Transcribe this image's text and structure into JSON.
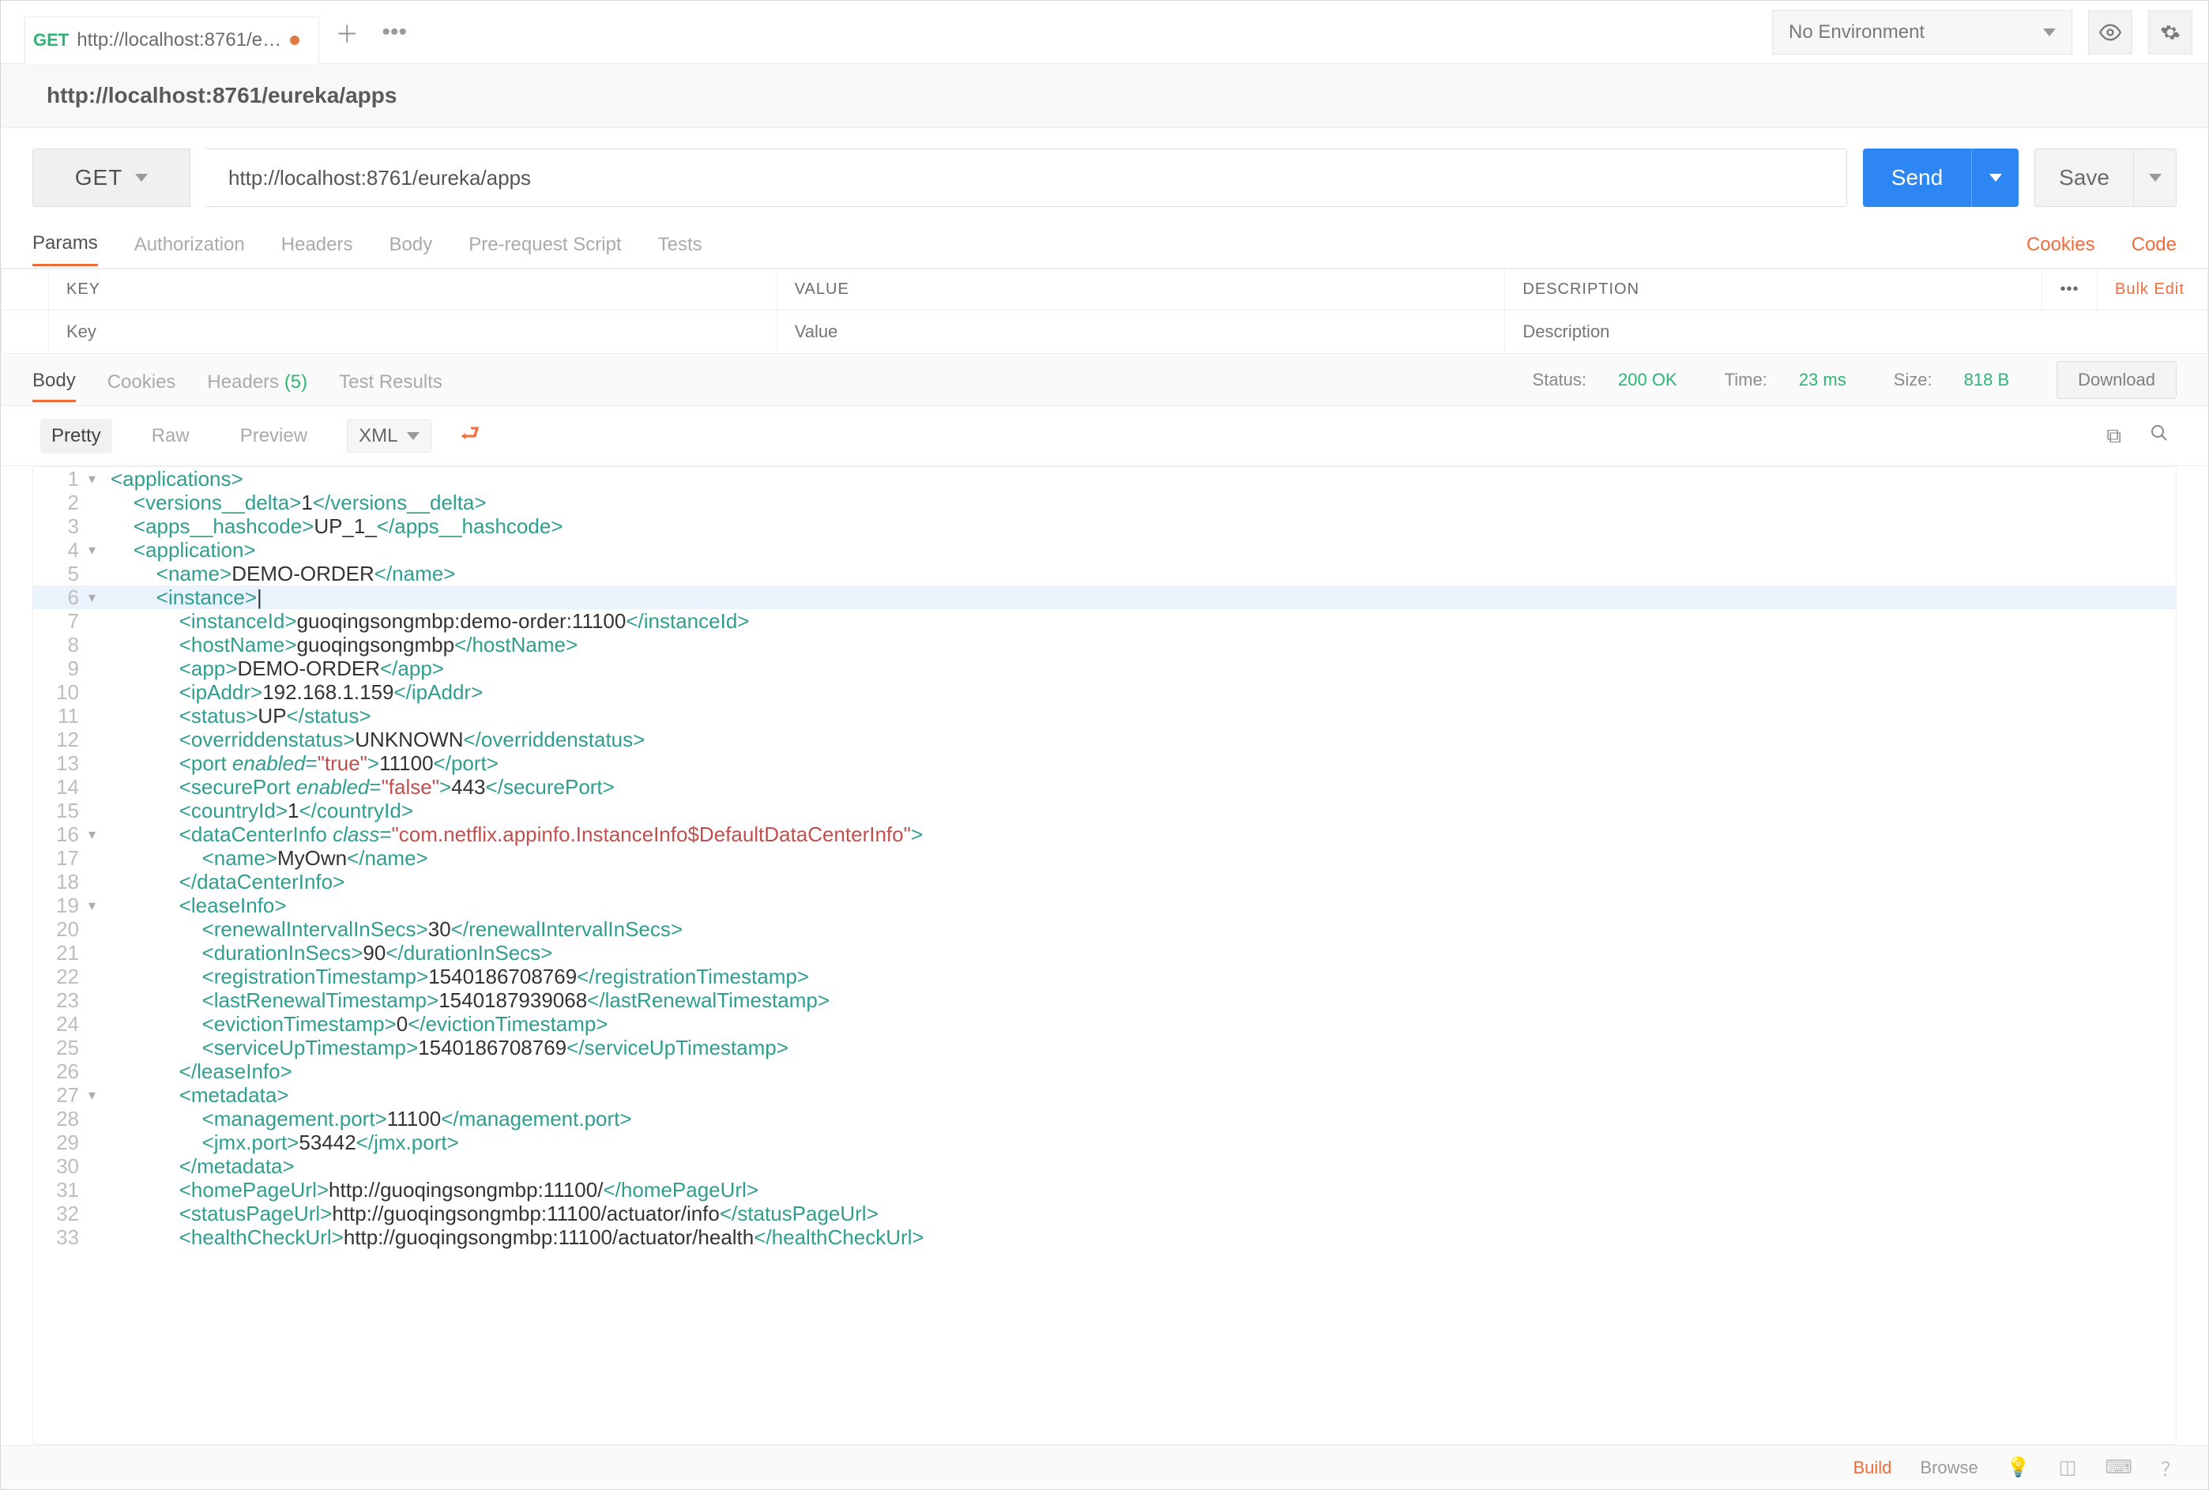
{
  "tab": {
    "method": "GET",
    "title": "http://localhost:8761/eureka/apps",
    "unsaved": true
  },
  "env": {
    "selected": "No Environment"
  },
  "request": {
    "title": "http://localhost:8761/eureka/apps",
    "method": "GET",
    "url": "http://localhost:8761/eureka/apps",
    "send": "Send",
    "save": "Save"
  },
  "request_tabs": [
    "Params",
    "Authorization",
    "Headers",
    "Body",
    "Pre-request Script",
    "Tests"
  ],
  "request_tabs_active": "Params",
  "cookies_link": "Cookies",
  "code_link": "Code",
  "params_headers": {
    "key": "KEY",
    "value": "VALUE",
    "desc": "DESCRIPTION",
    "bulk": "Bulk Edit"
  },
  "params_placeholders": {
    "key": "Key",
    "value": "Value",
    "desc": "Description"
  },
  "response_tabs": {
    "body": "Body",
    "cookies": "Cookies",
    "headers": "Headers",
    "headers_count": "(5)",
    "test_results": "Test Results"
  },
  "status": {
    "label": "Status:",
    "value": "200 OK"
  },
  "time": {
    "label": "Time:",
    "value": "23 ms"
  },
  "size": {
    "label": "Size:",
    "value": "818 B"
  },
  "download": "Download",
  "body_views": {
    "pretty": "Pretty",
    "raw": "Raw",
    "preview": "Preview",
    "format": "XML"
  },
  "footer": {
    "build": "Build",
    "browse": "Browse"
  },
  "eureka": {
    "versions_delta": "1",
    "apps_hashcode": "UP_1_",
    "application": {
      "name": "DEMO-ORDER",
      "instance": {
        "instanceId": "guoqingsongmbp:demo-order:11100",
        "hostName": "guoqingsongmbp",
        "app": "DEMO-ORDER",
        "ipAddr": "192.168.1.159",
        "status": "UP",
        "overriddenstatus": "UNKNOWN",
        "port": {
          "enabled": "true",
          "value": "11100"
        },
        "securePort": {
          "enabled": "false",
          "value": "443"
        },
        "countryId": "1",
        "dataCenterInfo": {
          "class": "com.netflix.appinfo.InstanceInfo$DefaultDataCenterInfo",
          "name": "MyOwn"
        },
        "leaseInfo": {
          "renewalIntervalInSecs": "30",
          "durationInSecs": "90",
          "registrationTimestamp": "1540186708769",
          "lastRenewalTimestamp": "1540187939068",
          "evictionTimestamp": "0",
          "serviceUpTimestamp": "1540186708769"
        },
        "metadata": {
          "management_port": "11100",
          "jmx_port": "53442"
        },
        "homePageUrl": "http://guoqingsongmbp:11100/",
        "statusPageUrl": "http://guoqingsongmbp:11100/actuator/info",
        "healthCheckUrl": "http://guoqingsongmbp:11100/actuator/health"
      }
    }
  }
}
